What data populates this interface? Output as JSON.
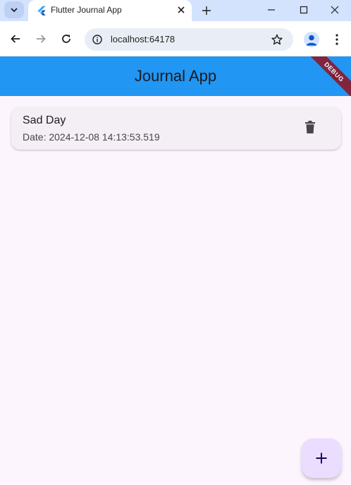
{
  "browser": {
    "tab": {
      "title": "Flutter Journal App",
      "favicon": "flutter-logo-icon"
    },
    "url": "localhost:64178",
    "controls": [
      "chevron-down-icon",
      "close-icon",
      "plus-icon",
      "minimize-icon",
      "maximize-icon",
      "window-close-icon",
      "back-icon",
      "forward-icon",
      "reload-icon",
      "site-info-icon",
      "bookmark-star-icon",
      "profile-icon",
      "kebab-menu-icon"
    ]
  },
  "app": {
    "title": "Journal App",
    "debug_banner": "DEBUG",
    "entries": [
      {
        "title": "Sad Day",
        "subtitle": "Date: 2024-12-08 14:13:53.519",
        "action_icon": "trash-icon"
      }
    ],
    "fab_icon": "plus-icon",
    "colors": {
      "appbar": "#2196f3",
      "background": "#fcf5fd",
      "card": "#f4eff4",
      "fab": "#eaddff",
      "debug_ribbon": "#8a1c2e"
    }
  }
}
